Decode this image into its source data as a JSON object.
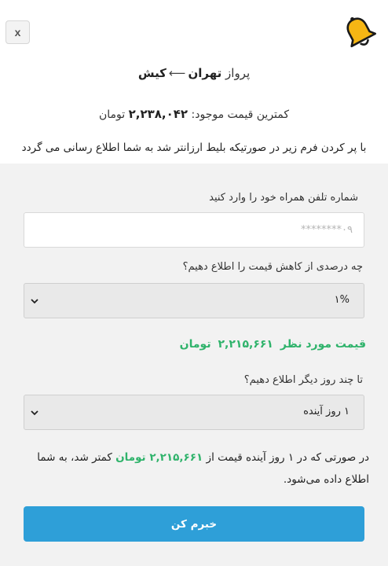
{
  "header": {
    "close_label": "x",
    "route_prefix": "پرواز",
    "origin": "تهران",
    "destination": "کیش",
    "min_price_label": "کمترین قیمت موجود:",
    "min_price_value": "۲,۲۳۸,۰۴۲",
    "min_price_unit": "تومان",
    "intro_text": "با پر کردن فرم زیر در صورتیکه بلیط ارزانتر شد به شما اطلاع رسانی می گردد"
  },
  "form": {
    "phone_label": "شماره تلفن همراه خود را وارد کنید",
    "phone_placeholder": "۰۹********",
    "percent_label": "چه درصدی از کاهش قیمت را اطلاع دهیم؟",
    "percent_selected": "۱%",
    "target_label": "قیمت مورد نظر",
    "target_value": "۲,۲۱۵,۶۶۱",
    "target_unit": "تومان",
    "days_label": "تا چند روز دیگر اطلاع دهیم؟",
    "days_selected": "۱ روز آینده",
    "notice_part1": "در صورتی که در ۱ روز آینده قیمت از",
    "notice_price": "۲,۲۱۵,۶۶۱ تومان",
    "notice_part2": "کمتر شد، به شما اطلاع داده می‌شود.",
    "submit_label": "خبرم کن"
  },
  "colors": {
    "accent_blue": "#2e9fd8",
    "accent_green": "#2fb36b",
    "bell_yellow": "#f6b614"
  }
}
